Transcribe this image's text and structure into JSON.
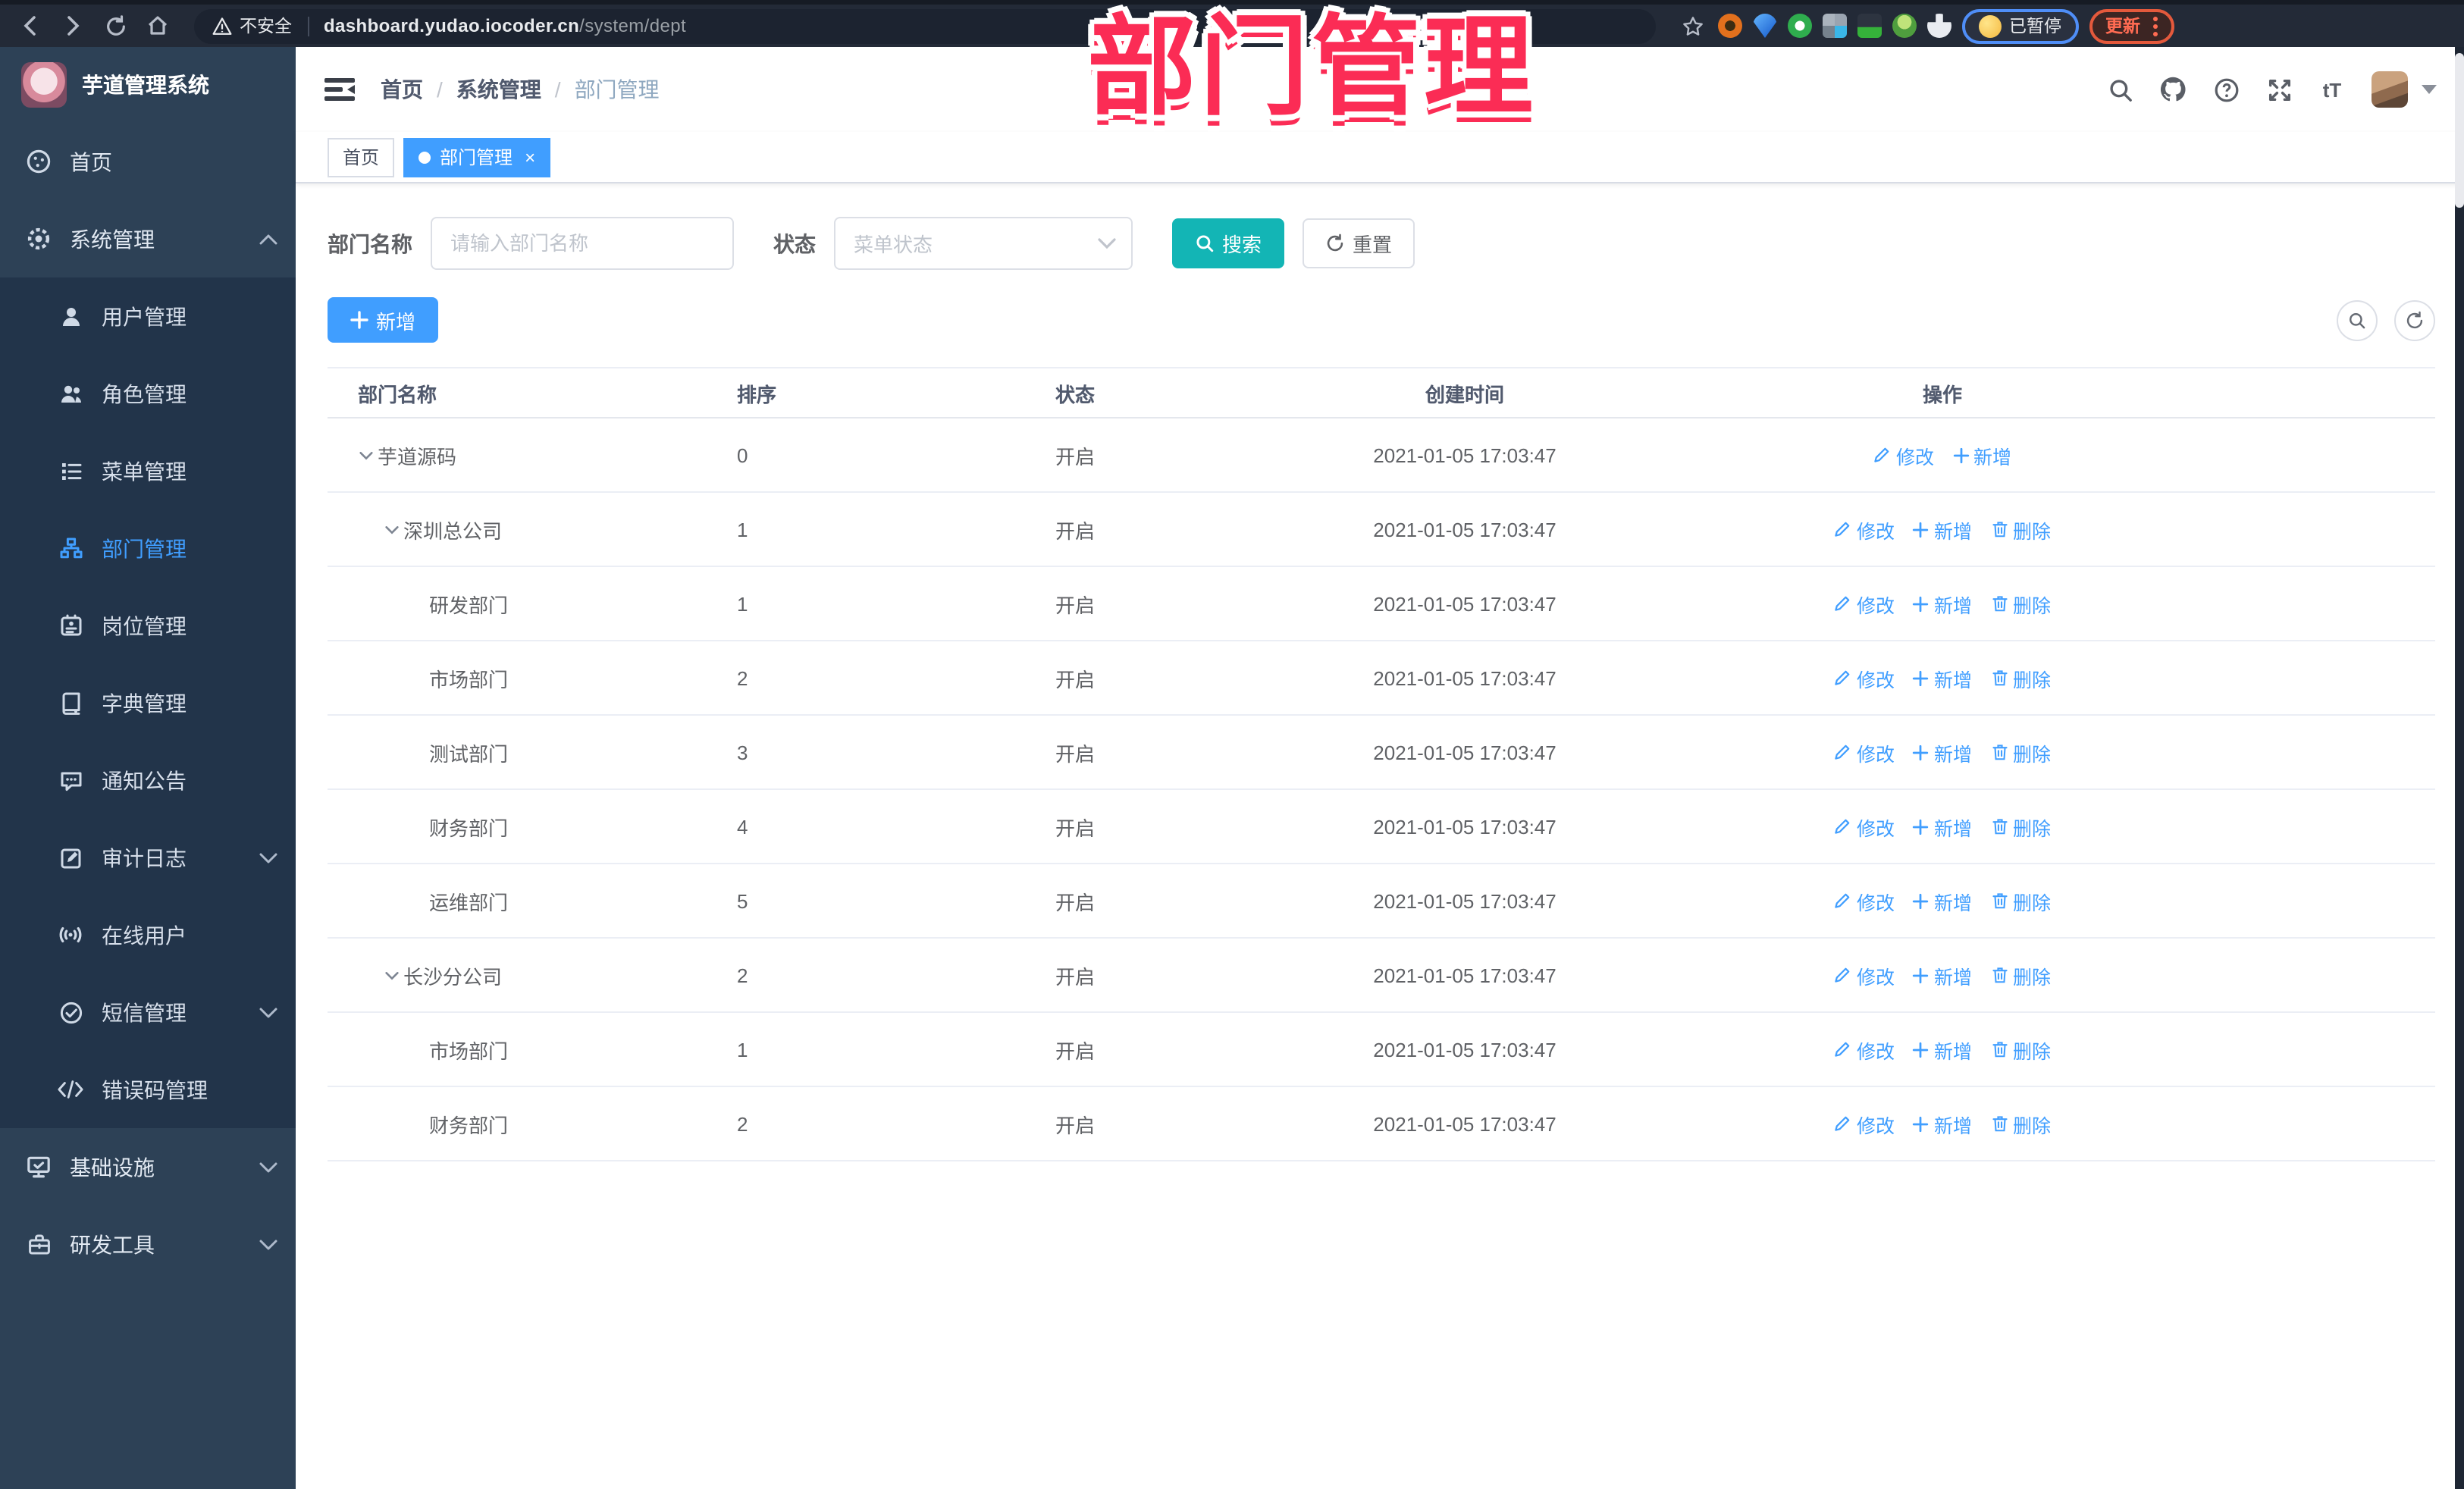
{
  "browser": {
    "security_label": "不安全",
    "url_domain": "dashboard.yudao.iocoder.cn",
    "url_path": "/system/dept",
    "profile_status": "已暂停",
    "update_label": "更新"
  },
  "annotation": {
    "text": "部门管理",
    "color": "#fb2c55"
  },
  "sidebar": {
    "app_title": "芋道管理系统",
    "menu": [
      {
        "label": "首页",
        "icon": "dashboard-icon",
        "type": "top",
        "arrow": null,
        "active": false
      },
      {
        "label": "系统管理",
        "icon": "gear-icon",
        "type": "top",
        "arrow": "up",
        "active": false
      },
      {
        "label": "用户管理",
        "icon": "user-icon",
        "type": "sub",
        "arrow": null,
        "active": false
      },
      {
        "label": "角色管理",
        "icon": "users-icon",
        "type": "sub",
        "arrow": null,
        "active": false
      },
      {
        "label": "菜单管理",
        "icon": "menu-list-icon",
        "type": "sub",
        "arrow": null,
        "active": false
      },
      {
        "label": "部门管理",
        "icon": "org-tree-icon",
        "type": "sub",
        "arrow": null,
        "active": true
      },
      {
        "label": "岗位管理",
        "icon": "badge-icon",
        "type": "sub",
        "arrow": null,
        "active": false
      },
      {
        "label": "字典管理",
        "icon": "book-icon",
        "type": "sub",
        "arrow": null,
        "active": false
      },
      {
        "label": "通知公告",
        "icon": "announcement-icon",
        "type": "sub",
        "arrow": null,
        "active": false
      },
      {
        "label": "审计日志",
        "icon": "edit-log-icon",
        "type": "sub",
        "arrow": "down",
        "active": false
      },
      {
        "label": "在线用户",
        "icon": "online-user-icon",
        "type": "sub",
        "arrow": null,
        "active": false
      },
      {
        "label": "短信管理",
        "icon": "sms-check-icon",
        "type": "sub",
        "arrow": "down",
        "active": false
      },
      {
        "label": "错误码管理",
        "icon": "code-icon",
        "type": "sub",
        "arrow": null,
        "active": false
      },
      {
        "label": "基础设施",
        "icon": "infrastructure-icon",
        "type": "top",
        "arrow": "down",
        "active": false
      },
      {
        "label": "研发工具",
        "icon": "toolbox-icon",
        "type": "top",
        "arrow": "down",
        "active": false
      }
    ]
  },
  "header": {
    "breadcrumb": [
      "首页",
      "系统管理",
      "部门管理"
    ]
  },
  "tabs": [
    {
      "label": "首页",
      "active": false,
      "closable": false
    },
    {
      "label": "部门管理",
      "active": true,
      "closable": true
    }
  ],
  "filter": {
    "name_label": "部门名称",
    "name_placeholder": "请输入部门名称",
    "status_label": "状态",
    "status_placeholder": "菜单状态",
    "search_label": "搜索",
    "reset_label": "重置"
  },
  "toolbar": {
    "add_label": "新增"
  },
  "table": {
    "columns": [
      "部门名称",
      "排序",
      "状态",
      "创建时间",
      "操作"
    ],
    "action_labels": {
      "modify": "修改",
      "add": "新增",
      "delete": "删除"
    },
    "rows": [
      {
        "name": "芋道源码",
        "level": 0,
        "expandable": true,
        "sort": "0",
        "status": "开启",
        "created": "2021-01-05 17:03:47",
        "deletable": false
      },
      {
        "name": "深圳总公司",
        "level": 1,
        "expandable": true,
        "sort": "1",
        "status": "开启",
        "created": "2021-01-05 17:03:47",
        "deletable": true
      },
      {
        "name": "研发部门",
        "level": 2,
        "expandable": false,
        "sort": "1",
        "status": "开启",
        "created": "2021-01-05 17:03:47",
        "deletable": true
      },
      {
        "name": "市场部门",
        "level": 2,
        "expandable": false,
        "sort": "2",
        "status": "开启",
        "created": "2021-01-05 17:03:47",
        "deletable": true
      },
      {
        "name": "测试部门",
        "level": 2,
        "expandable": false,
        "sort": "3",
        "status": "开启",
        "created": "2021-01-05 17:03:47",
        "deletable": true
      },
      {
        "name": "财务部门",
        "level": 2,
        "expandable": false,
        "sort": "4",
        "status": "开启",
        "created": "2021-01-05 17:03:47",
        "deletable": true
      },
      {
        "name": "运维部门",
        "level": 2,
        "expandable": false,
        "sort": "5",
        "status": "开启",
        "created": "2021-01-05 17:03:47",
        "deletable": true
      },
      {
        "name": "长沙分公司",
        "level": 1,
        "expandable": true,
        "sort": "2",
        "status": "开启",
        "created": "2021-01-05 17:03:47",
        "deletable": true
      },
      {
        "name": "市场部门",
        "level": 2,
        "expandable": false,
        "sort": "1",
        "status": "开启",
        "created": "2021-01-05 17:03:47",
        "deletable": true
      },
      {
        "name": "财务部门",
        "level": 2,
        "expandable": false,
        "sort": "2",
        "status": "开启",
        "created": "2021-01-05 17:03:47",
        "deletable": true
      }
    ]
  }
}
